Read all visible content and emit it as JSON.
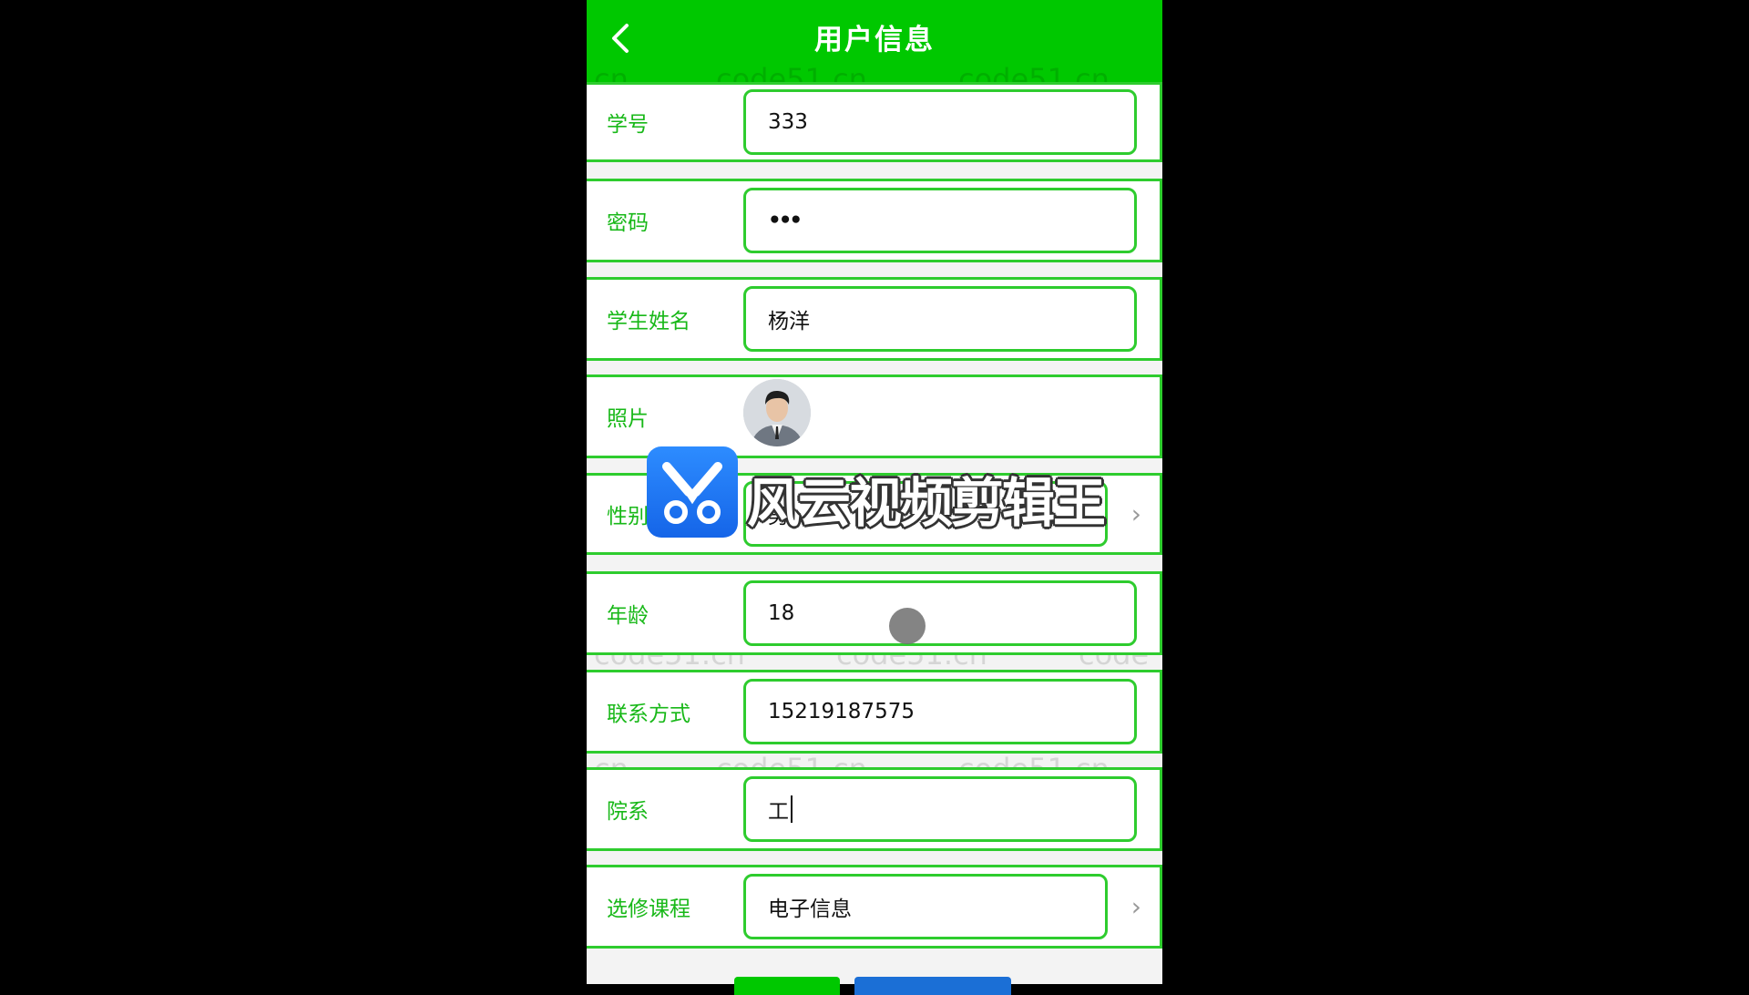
{
  "header": {
    "title": "用户信息",
    "back_icon": "chevron-left-icon"
  },
  "form": {
    "student_id": {
      "label": "学号",
      "value": "333"
    },
    "password": {
      "label": "密码",
      "value": "•••"
    },
    "student_name": {
      "label": "学生姓名",
      "value": "杨洋"
    },
    "photo": {
      "label": "照片"
    },
    "gender": {
      "label": "性别",
      "value": "男"
    },
    "age": {
      "label": "年龄",
      "value": "18"
    },
    "contact": {
      "label": "联系方式",
      "value": "15219187575"
    },
    "department": {
      "label": "院系",
      "value": "工"
    },
    "elective": {
      "label": "选修课程",
      "value": "电子信息"
    }
  },
  "watermark": {
    "text": "code51.cn",
    "partial_left": "cn",
    "partial_right": "code"
  },
  "overlay": {
    "app_name": "风云视频剪辑王",
    "icon": "scissors-icon"
  },
  "colors": {
    "header_bg": "#00c800",
    "accent": "#2ecc2e",
    "label": "#18b818",
    "overlay_blue": "#1b6fd6"
  }
}
